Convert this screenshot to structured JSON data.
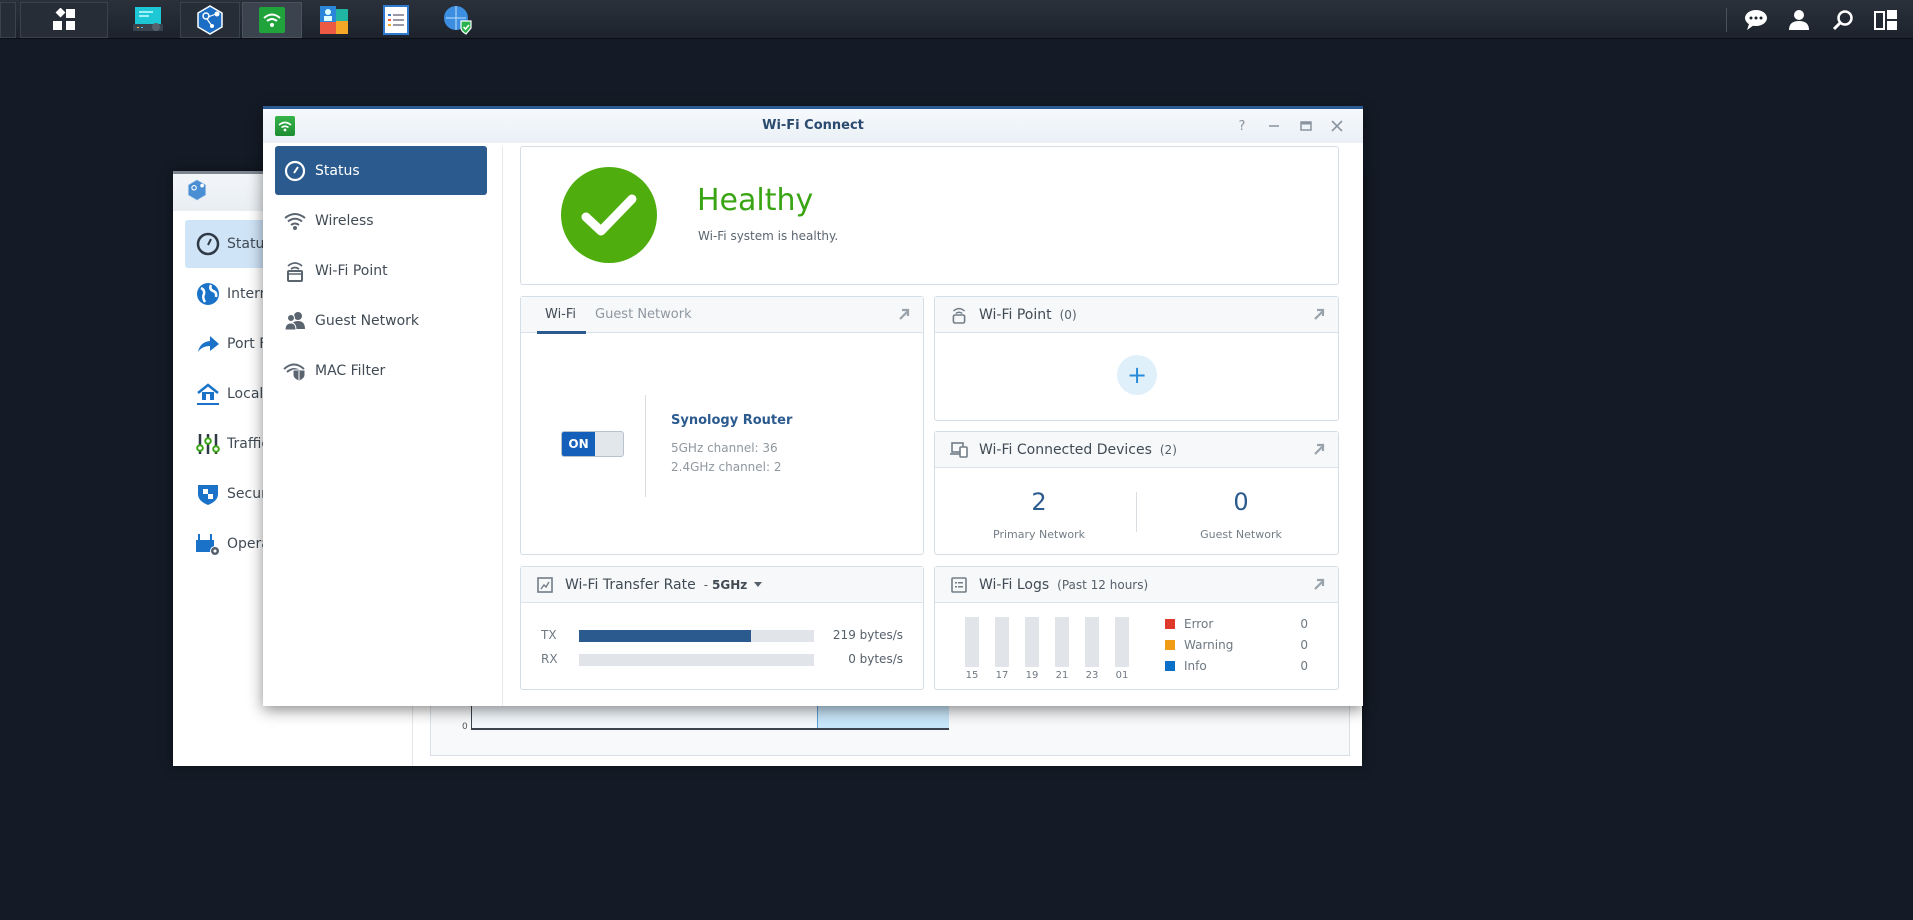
{
  "taskbar": {
    "left_items": [
      {
        "name": "main-menu",
        "icon": "grid-icon"
      },
      {
        "name": "app-control-panel",
        "icon": "router-console-icon"
      },
      {
        "name": "app-network-center",
        "icon": "network-center-icon"
      },
      {
        "name": "app-wifi-connect",
        "icon": "wifi-icon",
        "active": true
      },
      {
        "name": "app-safe-access",
        "icon": "safe-access-icon"
      },
      {
        "name": "app-log-center",
        "icon": "log-center-icon"
      },
      {
        "name": "app-vpn-plus",
        "icon": "globe-check-icon"
      }
    ],
    "right_items": [
      {
        "name": "notifications",
        "icon": "chat-icon"
      },
      {
        "name": "user-menu",
        "icon": "user-icon"
      },
      {
        "name": "search",
        "icon": "search-icon"
      },
      {
        "name": "widgets",
        "icon": "widgets-icon"
      }
    ]
  },
  "back_window": {
    "sidebar": [
      {
        "label": "Status",
        "icon": "gauge-icon",
        "selected": true
      },
      {
        "label": "Internet",
        "icon": "globe-icon"
      },
      {
        "label": "Port Forwarding",
        "icon": "arrow-forward-icon"
      },
      {
        "label": "Local Network",
        "icon": "home-network-icon"
      },
      {
        "label": "Traffic Control",
        "icon": "sliders-icon"
      },
      {
        "label": "Security",
        "icon": "shield-icon"
      },
      {
        "label": "Operation Mode",
        "icon": "router-gear-icon"
      }
    ],
    "chart": {
      "y_axis_zero": "0"
    }
  },
  "window": {
    "title": "Wi-Fi Connect",
    "controls": {
      "help": "?",
      "minimize": "–",
      "maximize": "□",
      "close": "X"
    }
  },
  "sidebar": {
    "items": [
      {
        "label": "Status",
        "icon": "gauge-icon",
        "selected": true
      },
      {
        "label": "Wireless",
        "icon": "wifi-icon"
      },
      {
        "label": "Wi-Fi Point",
        "icon": "wifi-point-icon"
      },
      {
        "label": "Guest Network",
        "icon": "guest-users-icon"
      },
      {
        "label": "MAC Filter",
        "icon": "wifi-shield-icon"
      }
    ]
  },
  "health": {
    "status": "Healthy",
    "description": "Wi-Fi system is healthy.",
    "color": "#4fae0e"
  },
  "wifi_card": {
    "tabs": [
      "Wi-Fi",
      "Guest Network"
    ],
    "active_tab": "Wi-Fi",
    "toggle_label": "ON",
    "toggle_on": true,
    "router_name": "Synology Router",
    "channel_5ghz": "5GHz channel:  36",
    "channel_24ghz": "2.4GHz channel:  2"
  },
  "wifi_point_card": {
    "title": "Wi-Fi Point",
    "count": "(0)",
    "add_label": "+"
  },
  "devices_card": {
    "title": "Wi-Fi Connected Devices",
    "count": "(2)",
    "primary_value": "2",
    "primary_label": "Primary Network",
    "guest_value": "0",
    "guest_label": "Guest Network"
  },
  "transfer_card": {
    "title": "Wi-Fi Transfer Rate",
    "band_prefix": "-",
    "band": "5GHz",
    "rows": [
      {
        "label": "TX",
        "value": "219 bytes/s",
        "fill": 0.73
      },
      {
        "label": "RX",
        "value": "0 bytes/s",
        "fill": 0
      }
    ]
  },
  "logs_card": {
    "title": "Wi-Fi Logs",
    "subtitle": "(Past 12 hours)",
    "hours": [
      "15",
      "17",
      "19",
      "21",
      "23",
      "01"
    ],
    "legend": [
      {
        "label": "Error",
        "value": "0",
        "color": "#e0392b"
      },
      {
        "label": "Warning",
        "value": "0",
        "color": "#f09c17"
      },
      {
        "label": "Info",
        "value": "0",
        "color": "#0a6fc9"
      }
    ]
  }
}
